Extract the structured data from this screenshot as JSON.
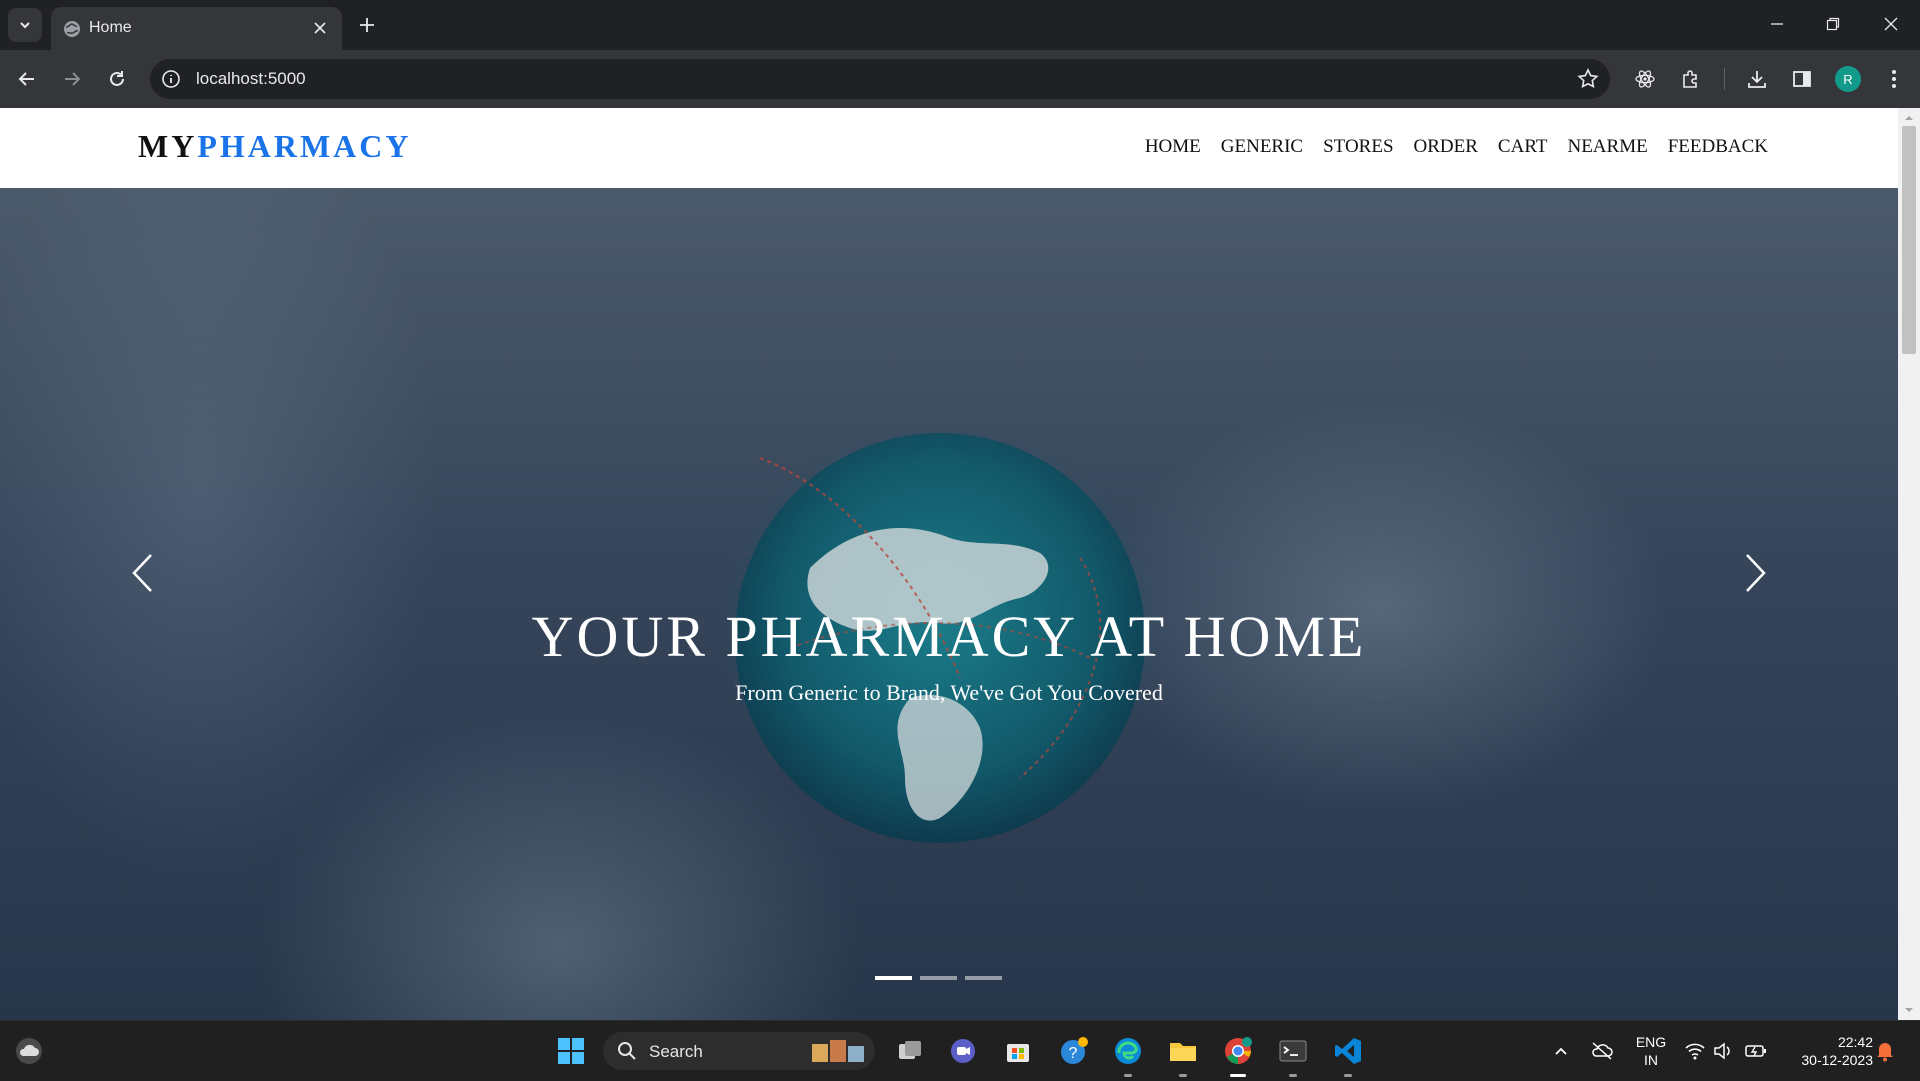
{
  "browser": {
    "tab_title": "Home",
    "url": "localhost:5000",
    "profile_initial": "R"
  },
  "site": {
    "brand_part1": "MY",
    "brand_part2": "PHARMACY",
    "nav": [
      "HOME",
      "GENERIC",
      "STORES",
      "ORDER",
      "CART",
      "NEARME",
      "FEEDBACK"
    ],
    "hero_title": "YOUR PHARMACY AT HOME",
    "hero_subtitle": "From Generic to Brand, We've Got You Covered",
    "carousel": {
      "slides": 3,
      "active_index": 0
    }
  },
  "taskbar": {
    "search_label": "Search",
    "lang_line1": "ENG",
    "lang_line2": "IN",
    "time": "22:42",
    "date": "30-12-2023"
  },
  "colors": {
    "brand_accent": "#1a73e8",
    "chrome_dark": "#202124",
    "toolbar": "#35363a"
  }
}
